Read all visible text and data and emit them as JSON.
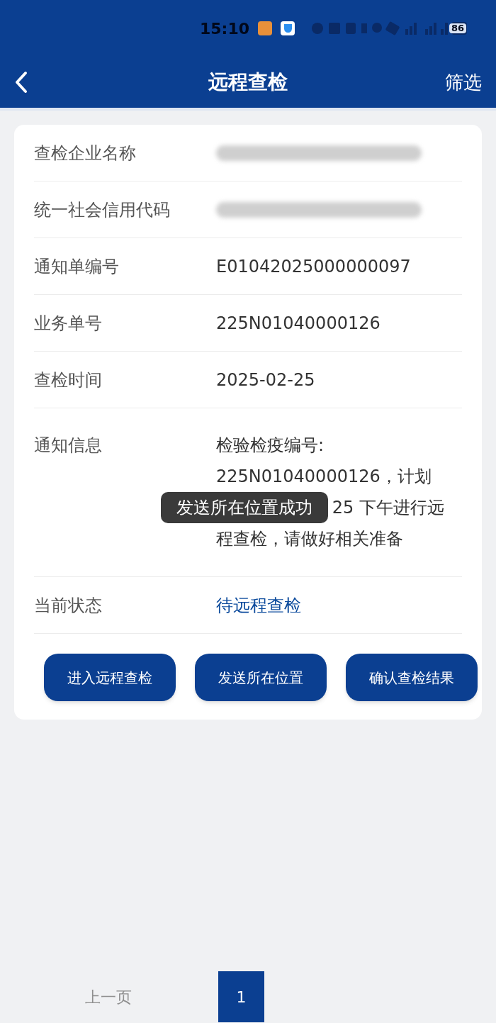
{
  "status_bar": {
    "time": "15:10",
    "battery": "86"
  },
  "nav": {
    "title": "远程查检",
    "action": "筛选"
  },
  "fields": [
    {
      "label": "查检企业名称",
      "kind": "redacted"
    },
    {
      "label": "统一社会信用代码",
      "kind": "redacted"
    },
    {
      "label": "通知单编号",
      "kind": "text",
      "value": "E01042025000000097"
    },
    {
      "label": "业务单号",
      "kind": "text",
      "value": "225N01040000126"
    },
    {
      "label": "查检时间",
      "kind": "text",
      "value": "2025-02-25"
    },
    {
      "label": "通知信息",
      "kind": "notice",
      "lines": [
        "检验检疫编号:",
        "225N01040000126，计划",
        "25 下午进行远",
        "程查检，请做好相关准备"
      ]
    },
    {
      "label": "当前状态",
      "kind": "status",
      "value": "待远程查检"
    }
  ],
  "buttons": [
    "进入远程查检",
    "发送所在位置",
    "确认查检结果"
  ],
  "toast": "发送所在位置成功",
  "pagination": {
    "prev": {
      "label": "上一页",
      "disabled": true
    },
    "pages": [
      {
        "label": "1",
        "selected": true
      }
    ]
  }
}
